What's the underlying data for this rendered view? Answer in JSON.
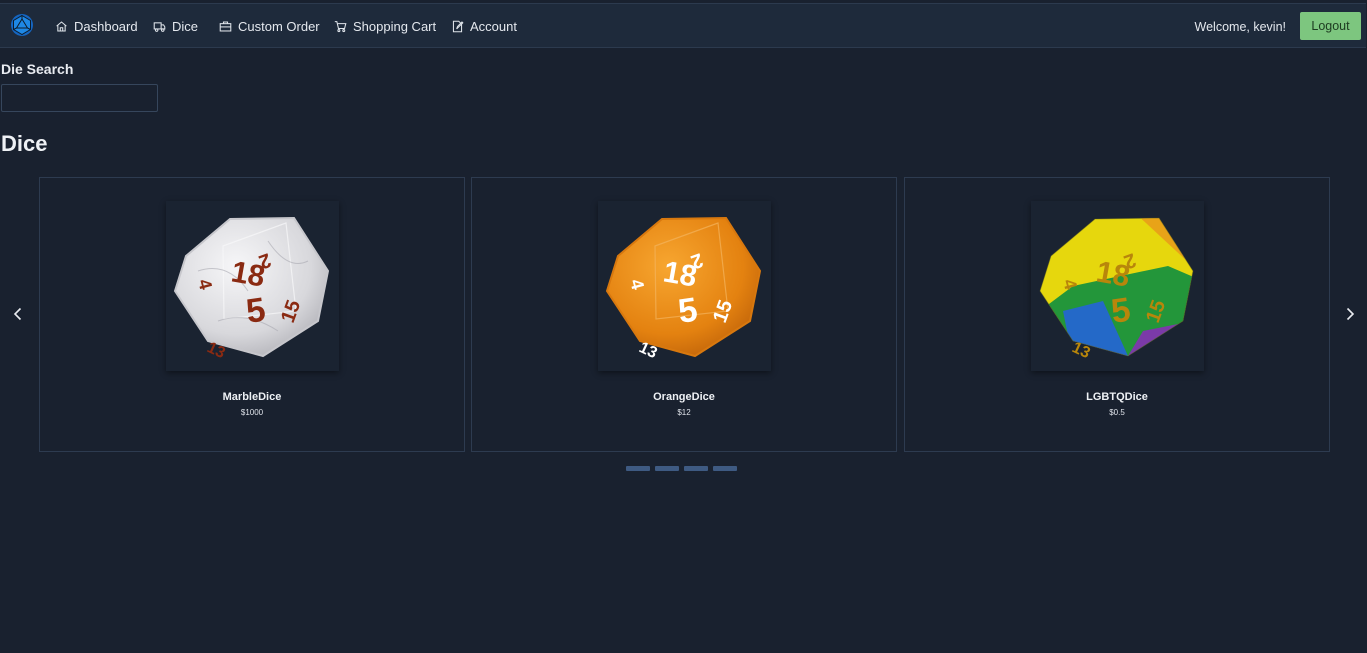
{
  "nav": {
    "brand_icon": "d20-logo-icon",
    "items": [
      {
        "label": "Dashboard",
        "icon": "home-icon"
      },
      {
        "label": "Dice",
        "icon": "truck-icon"
      },
      {
        "label": "Custom Order",
        "icon": "briefcase-icon"
      },
      {
        "label": "Shopping Cart",
        "icon": "cart-icon"
      },
      {
        "label": "Account",
        "icon": "edit-icon"
      }
    ],
    "welcome": "Welcome, kevin!",
    "logout_label": "Logout"
  },
  "search": {
    "label": "Die Search",
    "value": "",
    "placeholder": ""
  },
  "section_title": "Dice",
  "carousel": {
    "items": [
      {
        "name": "MarbleDice",
        "price": "$1000",
        "color": "#e4e4e6",
        "number_color": "#8a2a12"
      },
      {
        "name": "OrangeDice",
        "price": "$12",
        "color": "#e98a10",
        "number_color": "#ffffff"
      },
      {
        "name": "LGBTQDice",
        "price": "$0.5",
        "color": "#e8d80a",
        "number_color": "#b8860b"
      }
    ],
    "indicator_count": 4
  },
  "colors": {
    "background": "#19212f",
    "navbar": "#1e2a3b",
    "logout": "#7dc67f",
    "indicator": "#3e5a82"
  }
}
